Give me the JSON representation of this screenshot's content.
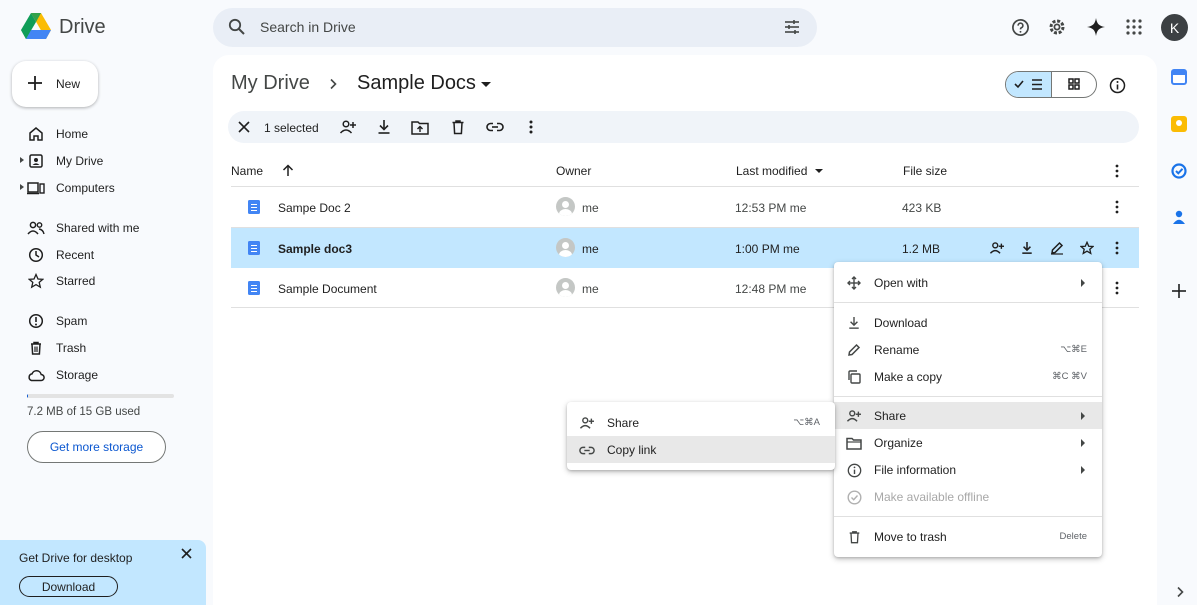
{
  "header": {
    "app_name": "Drive",
    "search_placeholder": "Search in Drive",
    "avatar_initial": "K"
  },
  "sidebar": {
    "new_label": "New",
    "items": [
      {
        "label": "Home"
      },
      {
        "label": "My Drive"
      },
      {
        "label": "Computers"
      },
      {
        "label": "Shared with me"
      },
      {
        "label": "Recent"
      },
      {
        "label": "Starred"
      },
      {
        "label": "Spam"
      },
      {
        "label": "Trash"
      },
      {
        "label": "Storage"
      }
    ],
    "storage_text": "7.2 MB of 15 GB used",
    "storage_used_fraction": 0.0005,
    "more_storage_label": "Get more storage",
    "promo": {
      "text": "Get Drive for desktop",
      "download_label": "Download"
    }
  },
  "main": {
    "breadcrumb_root": "My Drive",
    "breadcrumb_current": "Sample Docs",
    "selection": {
      "count_label": "1 selected"
    },
    "columns": {
      "name": "Name",
      "owner": "Owner",
      "modified": "Last modified",
      "size": "File size"
    },
    "files": [
      {
        "name": "Sampe Doc 2",
        "owner": "me",
        "modified": "12:53 PM  me",
        "size": "423 KB"
      },
      {
        "name": "Sample doc3",
        "owner": "me",
        "modified": "1:00 PM  me",
        "size": "1.2 MB"
      },
      {
        "name": "Sample Document",
        "owner": "me",
        "modified": "12:48 PM  me",
        "size": ""
      }
    ]
  },
  "context_menu": {
    "items": [
      {
        "label": "Open with",
        "shortcut": ""
      },
      {
        "label": "Download",
        "shortcut": ""
      },
      {
        "label": "Rename",
        "shortcut": "⌥⌘E"
      },
      {
        "label": "Make a copy",
        "shortcut": "⌘C ⌘V"
      },
      {
        "label": "Share",
        "shortcut": ""
      },
      {
        "label": "Organize",
        "shortcut": ""
      },
      {
        "label": "File information",
        "shortcut": ""
      },
      {
        "label": "Make available offline",
        "shortcut": ""
      },
      {
        "label": "Move to trash",
        "shortcut": "Delete"
      }
    ]
  },
  "share_submenu": {
    "items": [
      {
        "label": "Share",
        "shortcut": "⌥⌘A"
      },
      {
        "label": "Copy link",
        "shortcut": ""
      }
    ]
  },
  "colors": {
    "accent": "#0b57d0",
    "selected_row": "#c2e7ff",
    "background": "#f8fafd"
  }
}
